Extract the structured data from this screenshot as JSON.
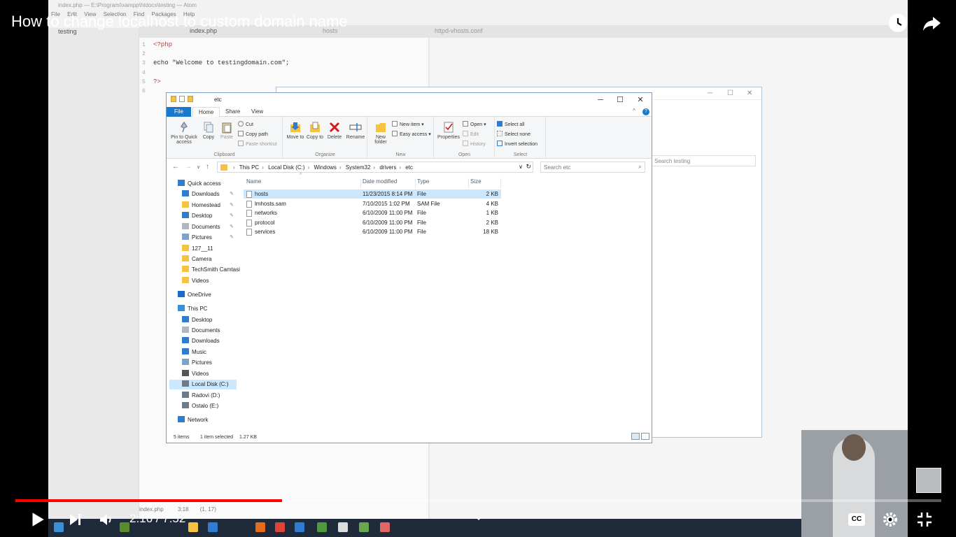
{
  "video": {
    "title": "How to change localhost to custom domain name",
    "current_time": "2:16",
    "duration": "7:52",
    "time_display": "2:16 / 7:52",
    "progress_fraction": 0.2882,
    "cc_label": "CC"
  },
  "editor": {
    "window_title": "index.php — E:\\Programi\\xampp\\htdocs\\testing — Atom",
    "menu": [
      "File",
      "Edit",
      "View",
      "Selection",
      "Find",
      "Packages",
      "Help"
    ],
    "project_folder": "testing",
    "tabs": [
      "index.php",
      "hosts",
      "httpd-vhosts.conf"
    ],
    "gutter": [
      "1",
      "2",
      "3",
      "4",
      "5",
      "6"
    ],
    "code_lines": [
      "<?php",
      "",
      "echo \"Welcome to testingdomain.com\";",
      "",
      " ?>",
      ""
    ],
    "status_file": "index.php",
    "status_pos": "3:18",
    "status_sel": "(1, 17)"
  },
  "explorer2": {
    "search_placeholder": "Search testing"
  },
  "explorer": {
    "title": "etc",
    "tabs": [
      "File",
      "Home",
      "Share",
      "View"
    ],
    "ribbon": {
      "clipboard": {
        "label": "Clipboard",
        "pin": "Pin to Quick access",
        "copy": "Copy",
        "paste": "Paste",
        "cut": "Cut",
        "copy_path": "Copy path",
        "paste_shortcut": "Paste shortcut"
      },
      "organize": {
        "label": "Organize",
        "move_to": "Move to",
        "copy_to": "Copy to",
        "delete": "Delete",
        "rename": "Rename"
      },
      "new": {
        "label": "New",
        "new_folder": "New folder",
        "new_item": "New item ▾",
        "easy_access": "Easy access ▾"
      },
      "open": {
        "label": "Open",
        "properties": "Properties",
        "open": "Open ▾",
        "edit": "Edit",
        "history": "History"
      },
      "select": {
        "label": "Select",
        "select_all": "Select all",
        "select_none": "Select none",
        "invert": "Invert selection"
      }
    },
    "breadcrumb": [
      "This PC",
      "Local Disk (C:)",
      "Windows",
      "System32",
      "drivers",
      "etc"
    ],
    "search_placeholder": "Search etc",
    "nav": [
      {
        "label": "Quick access",
        "icon": "star-icon",
        "color": "#2e7dd1"
      },
      {
        "label": "Downloads",
        "icon": "download-icon",
        "color": "#2e7dd1",
        "pinned": true
      },
      {
        "label": "Homestead",
        "icon": "folder-icon",
        "color": "#f5c242",
        "pinned": true
      },
      {
        "label": "Desktop",
        "icon": "desktop-icon",
        "color": "#2e7dd1",
        "pinned": true
      },
      {
        "label": "Documents",
        "icon": "documents-icon",
        "color": "#b0b7c0",
        "pinned": true
      },
      {
        "label": "Pictures",
        "icon": "pictures-icon",
        "color": "#7da3c9",
        "pinned": true
      },
      {
        "label": "127__11",
        "icon": "folder-icon",
        "color": "#f5c242"
      },
      {
        "label": "Camera",
        "icon": "folder-icon",
        "color": "#f5c242"
      },
      {
        "label": "TechSmith Camtasi",
        "icon": "folder-icon",
        "color": "#f5c242"
      },
      {
        "label": "Videos",
        "icon": "folder-icon",
        "color": "#f5c242"
      },
      {
        "label": "OneDrive",
        "icon": "cloud-icon",
        "color": "#1b6ac9"
      },
      {
        "label": "This PC",
        "icon": "computer-icon",
        "color": "#3b8fd6"
      },
      {
        "label": "Desktop",
        "icon": "desktop-icon",
        "color": "#2e7dd1"
      },
      {
        "label": "Documents",
        "icon": "documents-icon",
        "color": "#b0b7c0"
      },
      {
        "label": "Downloads",
        "icon": "download-icon",
        "color": "#2e7dd1"
      },
      {
        "label": "Music",
        "icon": "music-icon",
        "color": "#2e7dd1"
      },
      {
        "label": "Pictures",
        "icon": "pictures-icon",
        "color": "#7da3c9"
      },
      {
        "label": "Videos",
        "icon": "videos-icon",
        "color": "#555555"
      },
      {
        "label": "Local Disk (C:)",
        "icon": "drive-icon",
        "color": "#6d7a88",
        "selected": true
      },
      {
        "label": "Radovi (D:)",
        "icon": "drive-icon",
        "color": "#6d7a88"
      },
      {
        "label": "Ostalo (E:)",
        "icon": "drive-icon",
        "color": "#6d7a88"
      },
      {
        "label": "Network",
        "icon": "network-icon",
        "color": "#2e7dd1"
      }
    ],
    "columns": [
      "Name",
      "Date modified",
      "Type",
      "Size"
    ],
    "files": [
      {
        "name": "hosts",
        "date": "11/23/2015 8:14 PM",
        "type": "File",
        "size": "2 KB",
        "selected": true
      },
      {
        "name": "lmhosts.sam",
        "date": "7/10/2015 1:02 PM",
        "type": "SAM File",
        "size": "4 KB"
      },
      {
        "name": "networks",
        "date": "6/10/2009 11:00 PM",
        "type": "File",
        "size": "1 KB"
      },
      {
        "name": "protocol",
        "date": "6/10/2009 11:00 PM",
        "type": "File",
        "size": "2 KB"
      },
      {
        "name": "services",
        "date": "6/10/2009 11:00 PM",
        "type": "File",
        "size": "18 KB"
      }
    ],
    "status": {
      "items": "5 items",
      "selected": "1 item selected",
      "size": "1.27 KB"
    }
  },
  "colors": {
    "progress": "#ff0000",
    "selection": "#cce8ff",
    "file_tab": "#1979ca"
  }
}
